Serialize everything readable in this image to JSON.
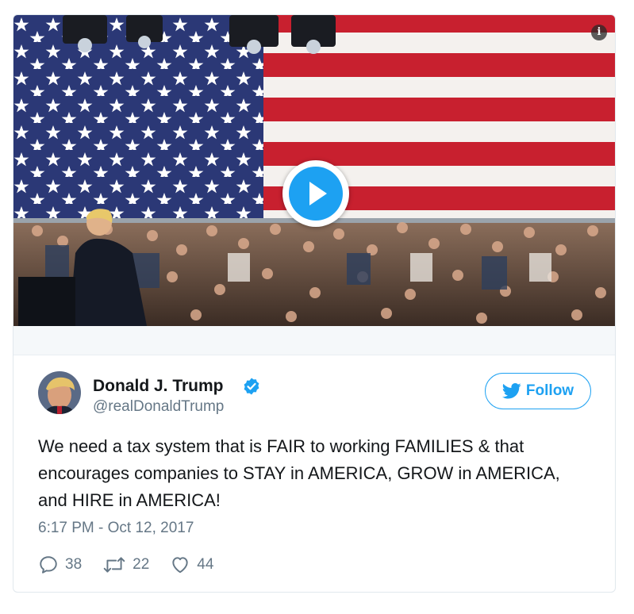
{
  "media": {
    "info_icon": "info-icon",
    "play_icon": "play-icon"
  },
  "tweet": {
    "display_name": "Donald J. Trump",
    "handle": "@realDonaldTrump",
    "verified": true,
    "follow_label": "Follow",
    "text": "We need a tax system that is FAIR to working FAMILIES & that encourages companies to STAY in AMERICA, GROW in AMERICA, and HIRE in AMERICA!",
    "timestamp": "6:17 PM - Oct 12, 2017",
    "replies": "38",
    "retweets": "22",
    "likes": "44"
  },
  "colors": {
    "accent": "#1da1f2",
    "secondary_text": "#657786",
    "flag_red": "#c8202f",
    "flag_blue": "#2b3876"
  }
}
